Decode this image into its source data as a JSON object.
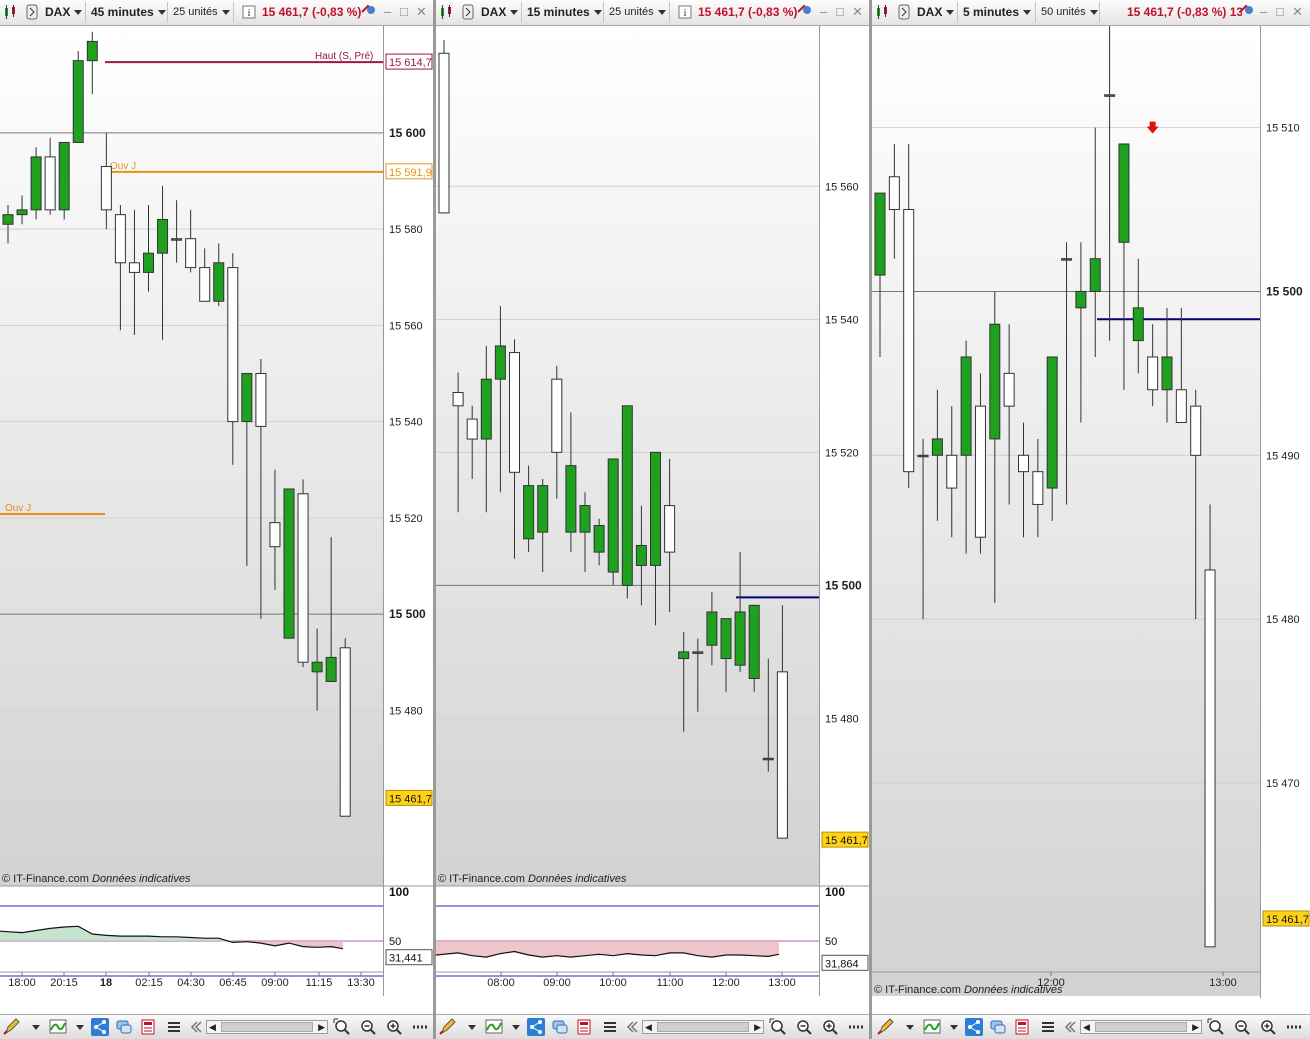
{
  "toolbar_icons": [
    "candlestick-icon",
    "chart-settings-icon",
    "info-icon",
    "alert-icon",
    "minimize-icon",
    "maximize-icon",
    "close-icon"
  ],
  "bottom_icons": [
    "draw-pencil-icon",
    "indicator-icon",
    "share-icon",
    "chat-icon",
    "calculator-icon",
    "list-icon",
    "scroll-left-double-icon",
    "zoom-out-icon",
    "zoom-in-icon",
    "more-icon"
  ],
  "colors": {
    "bull": "#1fa11f",
    "bear": "#ffffff",
    "price_badge": "#ffd21a",
    "red_text": "#c0112a",
    "orange": "#e8901a",
    "navy": "#00007a",
    "rsi_line": "#2a2ab8"
  },
  "credit_prefix": "© IT-Finance.com",
  "credit_suffix": "Données indicatives",
  "panels": [
    {
      "instrument": "DAX",
      "timeframe": "45 minutes",
      "units": "25 unités",
      "quote": "15 461,7 (-0,83 %)",
      "chart_data": {
        "type": "candlestick",
        "ylim": [
          15443.5,
          15622.2
        ],
        "yticks": [
          "15 480",
          "15 500",
          "15 520",
          "15 540",
          "15 560",
          "15 580",
          "15 600"
        ],
        "yticks_bold": [
          "15 500",
          "15 600"
        ],
        "xticks": [
          "18:00",
          "20:15",
          "18",
          "02:15",
          "04:30",
          "06:45",
          "09:00",
          "11:15",
          "13:30"
        ],
        "xticks_bold": [
          "18"
        ],
        "price_label": "15 461,7",
        "candles": [
          [
            15581,
            15585,
            15577,
            15583
          ],
          [
            15583,
            15587,
            15581,
            15584
          ],
          [
            15584,
            15597,
            15582,
            15595
          ],
          [
            15595,
            15599,
            15583,
            15584
          ],
          [
            15584,
            15598,
            15582,
            15598
          ],
          [
            15598,
            15617,
            15598,
            15615
          ],
          [
            15615,
            15621,
            15608,
            15619
          ],
          [
            15593,
            15600,
            15580,
            15584
          ],
          [
            15583,
            15585,
            15559,
            15573
          ],
          [
            15573,
            15584,
            15558,
            15571
          ],
          [
            15571,
            15585,
            15567,
            15575
          ],
          [
            15575,
            15589,
            15557,
            15582
          ],
          [
            15578,
            15586,
            15573,
            15578
          ],
          [
            15578,
            15584,
            15571,
            15572
          ],
          [
            15572,
            15576,
            15565,
            15565
          ],
          [
            15565,
            15577,
            15564,
            15573
          ],
          [
            15572,
            15575,
            15531,
            15540
          ],
          [
            15540,
            15533,
            15510,
            15550
          ],
          [
            15550,
            15553,
            15499,
            15539
          ],
          [
            15519,
            15530,
            15505,
            15514
          ],
          [
            15495,
            15526,
            15495,
            15526
          ],
          [
            15525,
            15528,
            15489,
            15490
          ],
          [
            15488,
            15497,
            15480,
            15490
          ],
          [
            15486,
            15516,
            15486,
            15491
          ],
          [
            15493,
            15495,
            15458,
            15458
          ]
        ],
        "hlines": [
          {
            "label": "15 614,7",
            "text": "Haut (S, Pré)",
            "value": 15614.7,
            "color": "#9a1840"
          },
          {
            "label": "15 591,9",
            "text": "Ouv J",
            "value": 15591.9,
            "color": "#e8901a"
          },
          {
            "label": "",
            "text": "Ouv J",
            "value": 15520.8,
            "color": "#e8901a"
          }
        ],
        "rsi": {
          "value": "31,441",
          "levels": [
            "100",
            "50"
          ],
          "color": "#2a2ab8",
          "values": [
            64,
            62,
            65,
            68,
            70,
            71,
            60,
            58,
            57,
            57,
            57,
            56,
            56,
            55,
            54,
            54,
            48,
            49,
            47,
            43,
            47,
            42,
            41,
            42,
            39
          ]
        }
      }
    },
    {
      "instrument": "DAX",
      "timeframe": "15 minutes",
      "units": "25 unités",
      "quote": "15 461,7 (-0,83 %)",
      "chart_data": {
        "type": "candlestick",
        "ylim": [
          15454.8,
          15584.1
        ],
        "yticks": [
          "15 480",
          "15 500",
          "15 520",
          "15 540",
          "15 560"
        ],
        "yticks_bold": [
          "15 500"
        ],
        "xticks": [
          "08:00",
          "09:00",
          "10:00",
          "11:00",
          "12:00",
          "13:00"
        ],
        "xticks_bold": [],
        "price_label": "15 461,7",
        "candles": [
          [
            15580,
            15582,
            15556,
            15556
          ],
          [
            15529,
            15532,
            15511,
            15527
          ],
          [
            15525,
            15527,
            15516,
            15522
          ],
          [
            15522,
            15536,
            15511,
            15531
          ],
          [
            15531,
            15542,
            15514,
            15536
          ],
          [
            15535,
            15537,
            15504,
            15517
          ],
          [
            15507,
            15518,
            15505,
            15515
          ],
          [
            15508,
            15516,
            15502,
            15515
          ],
          [
            15531,
            15533,
            15513,
            15520
          ],
          [
            15508,
            15526,
            15505,
            15518
          ],
          [
            15508,
            15514,
            15502,
            15512
          ],
          [
            15505,
            15510,
            15503,
            15509
          ],
          [
            15502,
            15508,
            15500,
            15519
          ],
          [
            15500,
            15525,
            15498,
            15527
          ],
          [
            15503,
            15512,
            15497,
            15506
          ],
          [
            15503,
            15512,
            15494,
            15520
          ],
          [
            15512,
            15519,
            15496,
            15505
          ],
          [
            15489,
            15493,
            15478,
            15490
          ],
          [
            15490,
            15492,
            15481,
            15490
          ],
          [
            15491,
            15499,
            15488,
            15496
          ],
          [
            15489,
            15492,
            15484,
            15495
          ],
          [
            15488,
            15505,
            15487,
            15496
          ],
          [
            15486,
            15493,
            15484,
            15497
          ],
          [
            15474,
            15489,
            15472,
            15474
          ],
          [
            15487,
            15497,
            15465,
            15462
          ]
        ],
        "hlines": [],
        "rsi": {
          "value": "31,864",
          "levels": [
            "100",
            "50"
          ],
          "color": "#2a2ab8",
          "values": [
            30,
            33,
            29,
            27,
            32,
            35,
            30,
            27,
            29,
            27,
            29,
            31,
            29,
            32,
            30,
            29,
            33,
            33,
            29,
            27,
            30,
            30,
            29,
            28,
            31
          ]
        }
      }
    },
    {
      "instrument": "DAX",
      "timeframe": "5 minutes",
      "units": "50 unités",
      "quote": "15 461,7 (-0,83 %) 13",
      "chart_data": {
        "type": "candlestick",
        "ylim": [
          15457.0,
          15516.2
        ],
        "yticks": [
          "15 470",
          "15 480",
          "15 490",
          "15 500",
          "15 510"
        ],
        "yticks_bold": [
          "15 500"
        ],
        "xticks": [
          "12:00",
          "13:00"
        ],
        "xticks_bold": [],
        "price_label": "15 461,7",
        "candles": [
          [
            15501,
            15505,
            15496,
            15506
          ],
          [
            15507,
            15509,
            15502,
            15505
          ],
          [
            15505,
            15509,
            15488,
            15489
          ],
          [
            15490,
            15491,
            15480,
            15490
          ],
          [
            15490,
            15494,
            15486,
            15491
          ],
          [
            15490,
            15493,
            15485,
            15488
          ],
          [
            15490,
            15497,
            15484,
            15496
          ],
          [
            15493,
            15495,
            15484,
            15485
          ],
          [
            15491,
            15500,
            15481,
            15498
          ],
          [
            15495,
            15498,
            15487,
            15493
          ],
          [
            15490,
            15492,
            15485,
            15489
          ],
          [
            15489,
            15491,
            15485,
            15487
          ],
          [
            15488,
            15496,
            15486,
            15496
          ],
          [
            15502,
            15503,
            15487,
            15502
          ],
          [
            15499,
            15503,
            15492,
            15500
          ],
          [
            15500,
            15510,
            15496,
            15502
          ],
          [
            15512,
            15519,
            15497,
            15512
          ],
          [
            15503,
            15507,
            15494,
            15509
          ],
          [
            15497,
            15502,
            15495,
            15499
          ],
          [
            15496,
            15498,
            15493,
            15494
          ],
          [
            15494,
            15499,
            15492,
            15496
          ],
          [
            15494,
            15499,
            15493,
            15492
          ],
          [
            15493,
            15494,
            15480,
            15490
          ],
          [
            15483,
            15487,
            15463,
            15460
          ]
        ],
        "hlines": [],
        "rsi": null
      }
    }
  ]
}
